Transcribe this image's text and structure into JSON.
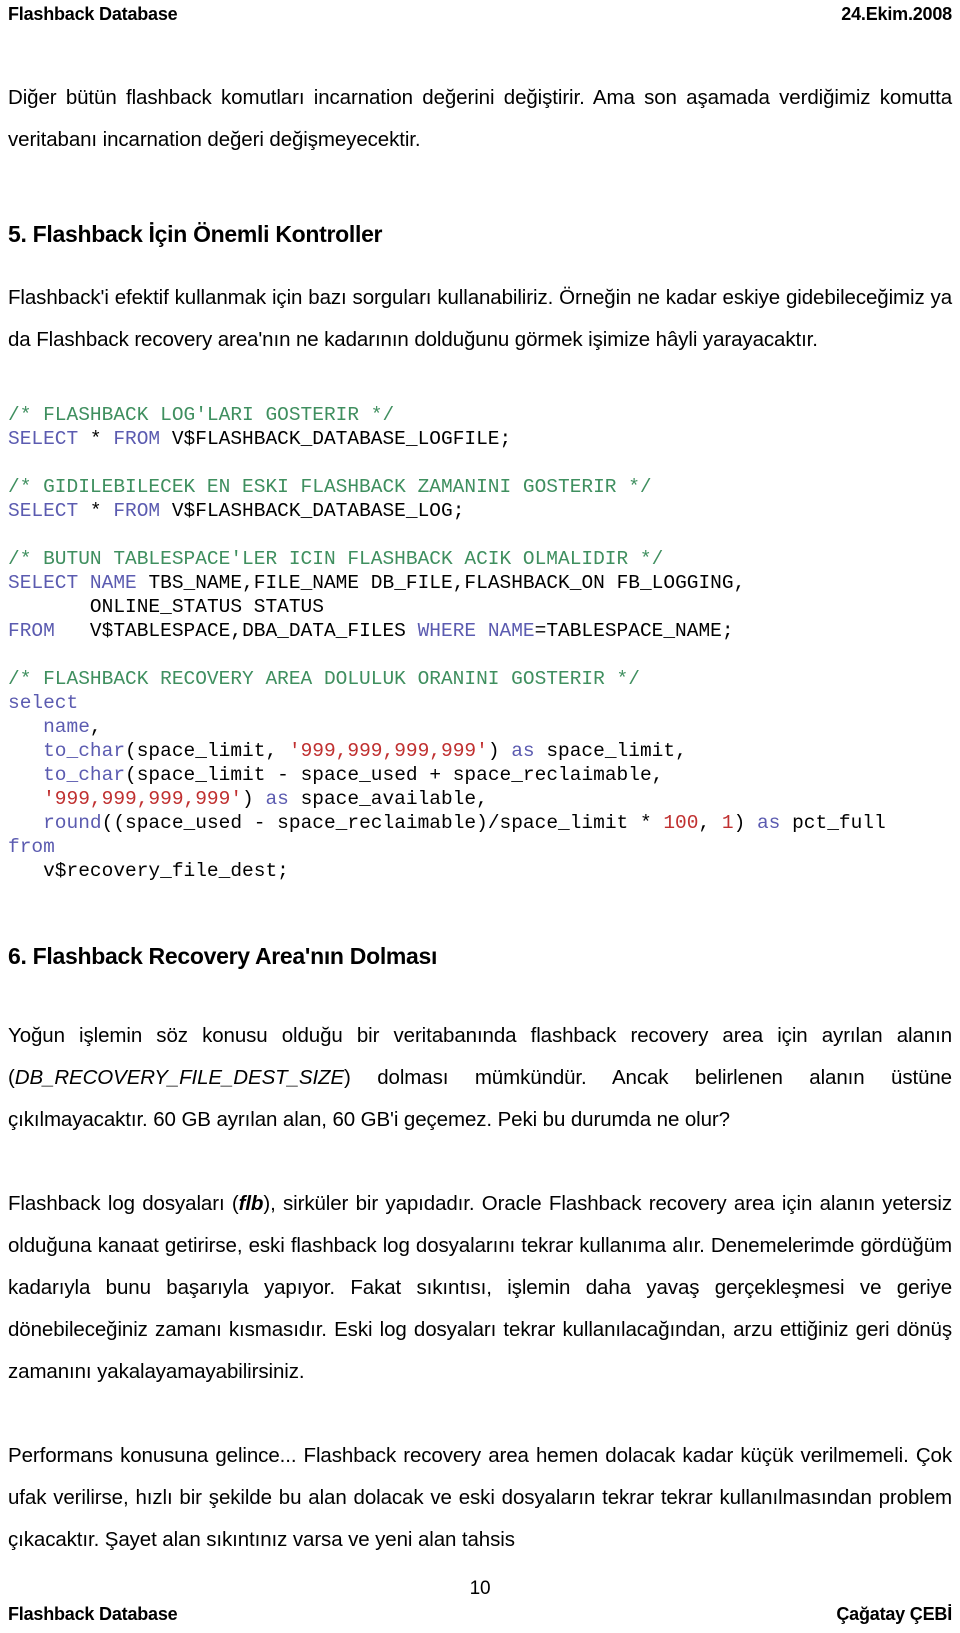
{
  "header": {
    "left": "Flashback Database",
    "right": "24.Ekim.2008"
  },
  "content": {
    "intro_paragraph": "Diğer bütün flashback komutları incarnation değerini değiştirir. Ama son aşamada verdiğimiz komutta veritabanı incarnation değeri değişmeyecektir.",
    "section5_heading": "5. Flashback İçin Önemli Kontroller",
    "section5_paragraph": "Flashback'i efektif kullanmak için bazı sorguları kullanabiliriz. Örneğin ne kadar eskiye gidebileceğimiz ya da Flashback recovery area'nın ne kadarının dolduğunu görmek işimize hâyli yarayacaktır.",
    "section6_heading": "6. Flashback Recovery Area'nın Dolması",
    "section6_p1_a": "Yoğun işlemin söz konusu olduğu bir veritabanında flashback recovery area için ayrılan alanın (",
    "section6_p1_italic": "DB_RECOVERY_FILE_DEST_SIZE",
    "section6_p1_b": ") dolması mümkündür. Ancak belirlenen alanın üstüne çıkılmayacaktır. 60 GB ayrılan alan, 60 GB'i geçemez. Peki bu durumda ne olur?",
    "section6_p2_a": "Flashback log dosyaları (",
    "section6_p2_bolditalic": "flb",
    "section6_p2_b": "), sirküler bir yapıdadır. Oracle Flashback recovery area için alanın yetersiz olduğuna kanaat getirirse, eski flashback log dosyalarını tekrar kullanıma alır. Denemelerimde gördüğüm kadarıyla bunu başarıyla yapıyor. Fakat sıkıntısı, işlemin daha yavaş gerçekleşmesi ve geriye dönebileceğiniz zamanı kısmasıdır. Eski log dosyaları tekrar kullanılacağından, arzu ettiğiniz geri dönüş zamanını yakalayamayabilirsiniz.",
    "section6_p3": "Performans konusuna gelince... Flashback recovery area hemen dolacak kadar küçük verilmemeli. Çok ufak verilirse, hızlı bir şekilde bu alan dolacak ve eski dosyaların tekrar tekrar kullanılmasından problem çıkacaktır. Şayet alan sıkıntınız varsa ve yeni alan tahsis"
  },
  "code_block": {
    "lines": [
      {
        "kind": "comment",
        "text": "/* FLASHBACK LOG'LARI GOSTERIR */"
      },
      {
        "kind": "sql",
        "text": "SELECT * FROM V$FLASHBACK_DATABASE_LOGFILE;"
      },
      {
        "kind": "blank",
        "text": ""
      },
      {
        "kind": "comment",
        "text": "/* GIDILEBILECEK EN ESKI FLASHBACK ZAMANINI GOSTERIR */"
      },
      {
        "kind": "sql",
        "text": "SELECT * FROM V$FLASHBACK_DATABASE_LOG;"
      },
      {
        "kind": "blank",
        "text": ""
      },
      {
        "kind": "comment",
        "text": "/* BUTUN TABLESPACE'LER ICIN FLASHBACK ACIK OLMALIDIR */"
      },
      {
        "kind": "sql",
        "text": "SELECT NAME TBS_NAME,FILE_NAME DB_FILE,FLASHBACK_ON FB_LOGGING,"
      },
      {
        "kind": "sql",
        "text": "       ONLINE_STATUS STATUS"
      },
      {
        "kind": "sql",
        "text": "FROM   V$TABLESPACE,DBA_DATA_FILES WHERE NAME=TABLESPACE_NAME;"
      },
      {
        "kind": "blank",
        "text": ""
      },
      {
        "kind": "comment",
        "text": "/* FLASHBACK RECOVERY AREA DOLULUK ORANINI GOSTERIR */"
      },
      {
        "kind": "sql",
        "text": "select"
      },
      {
        "kind": "sql",
        "text": "   name,"
      },
      {
        "kind": "sql",
        "text": "   to_char(space_limit, '999,999,999,999') as space_limit,"
      },
      {
        "kind": "sql",
        "text": "   to_char(space_limit - space_used + space_reclaimable,"
      },
      {
        "kind": "sql",
        "text": "   '999,999,999,999') as space_available,"
      },
      {
        "kind": "sql",
        "text": "   round((space_used - space_reclaimable)/space_limit * 100, 1) as pct_full"
      },
      {
        "kind": "sql",
        "text": "from"
      },
      {
        "kind": "sql",
        "text": "   v$recovery_file_dest;"
      }
    ],
    "colors": {
      "comment": "#3f8f5f",
      "keyword": "#5b5bb0",
      "string": "#c03030",
      "plain": "#000000"
    }
  },
  "footer": {
    "page_number": "10",
    "left": "Flashback Database",
    "right": "Çağatay ÇEBİ"
  }
}
